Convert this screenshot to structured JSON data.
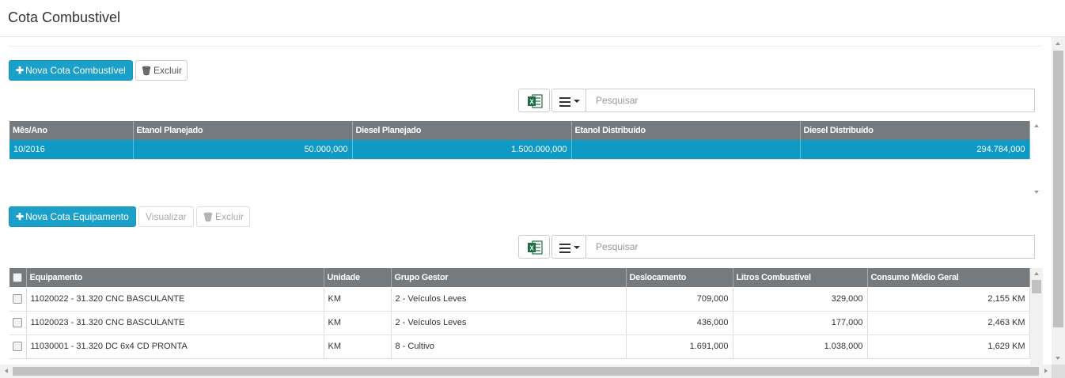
{
  "page": {
    "title": "Cota Combustivel"
  },
  "section1": {
    "new_button": "Nova Cota Combustível",
    "delete_button": "Excluir",
    "search_placeholder": "Pesquisar",
    "columns": [
      "Mês/Ano",
      "Etanol Planejado",
      "Diesel Planejado",
      "Etanol Distribuído",
      "Diesel Distribuído"
    ],
    "rows": [
      {
        "mes_ano": "10/2016",
        "etanol_planejado": "50.000,000",
        "diesel_planejado": "1.500.000,000",
        "etanol_distribuido": "",
        "diesel_distribuido": "294.784,000"
      }
    ]
  },
  "section2": {
    "new_button": "Nova Cota Equipamento",
    "view_button": "Visualizar",
    "delete_button": "Excluir",
    "search_placeholder": "Pesquisar",
    "columns": [
      "Equipamento",
      "Unidade",
      "Grupo Gestor",
      "Deslocamento",
      "Litros Combustível",
      "Consumo Médio Geral"
    ],
    "rows": [
      {
        "equipamento": "11020022 - 31.320 CNC BASCULANTE",
        "unidade": "KM",
        "grupo": "2 - Veículos Leves",
        "deslocamento": "709,000",
        "litros": "329,000",
        "consumo": "2,155 KM"
      },
      {
        "equipamento": "11020023 - 31.320 CNC BASCULANTE",
        "unidade": "KM",
        "grupo": "2 - Veículos Leves",
        "deslocamento": "436,000",
        "litros": "177,000",
        "consumo": "2,463 KM"
      },
      {
        "equipamento": "11030001 - 31.320 DC 6x4 CD PRONTA",
        "unidade": "KM",
        "grupo": "8 - Cultivo",
        "deslocamento": "1.691,000",
        "litros": "1.038,000",
        "consumo": "1,629 KM"
      }
    ]
  },
  "colors": {
    "primary": "#1ba1c9",
    "selected_row": "#0e9ac4",
    "header_bg": "#747a7d",
    "excel_green": "#1d7044"
  },
  "icons": {
    "add": "plus-icon",
    "delete": "trash-icon",
    "export": "excel-icon",
    "columns_menu": "list-menu-icon"
  }
}
